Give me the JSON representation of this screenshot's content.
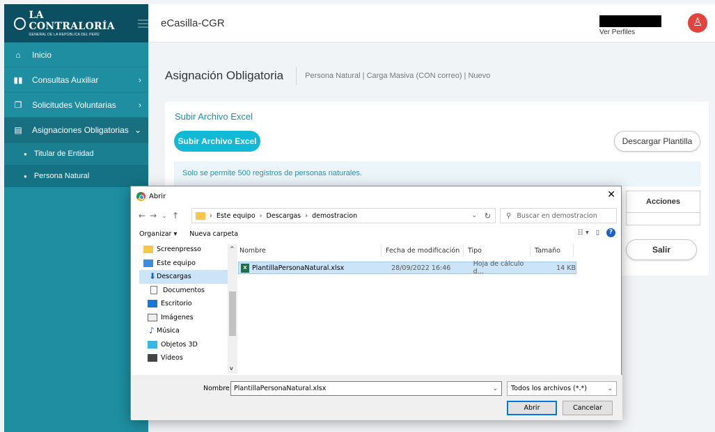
{
  "sidebar": {
    "logo_title": "LA CONTRALORÍA",
    "logo_subtitle": "GENERAL DE LA REPÚBLICA DEL PERÚ",
    "items": [
      {
        "label": "Inicio",
        "icon": "home-icon",
        "chevron": ""
      },
      {
        "label": "Consultas Auxiliar",
        "icon": "bar-chart-icon",
        "chevron": "›"
      },
      {
        "label": "Solicitudes Voluntarias",
        "icon": "document-copy-icon",
        "chevron": "›"
      },
      {
        "label": "Asignaciones Obligatorias",
        "icon": "clipboard-icon",
        "chevron": "⌄"
      }
    ],
    "subitems": [
      {
        "label": "Titular de Entidad"
      },
      {
        "label": "Persona Natural"
      }
    ]
  },
  "topbar": {
    "app_title": "eCasilla-CGR",
    "ver_perfiles": "Ver Perfiles",
    "avatar_icon": "user-icon"
  },
  "page": {
    "title": "Asignación Obligatoria",
    "subtitle": "Persona Natural | Carga Masiva (CON correo) | Nuevo"
  },
  "card": {
    "title": "Subir Archivo Excel",
    "upload_label": "Subir Archivo Excel",
    "download_label": "Descargar Plantilla",
    "notice": "Solo se permite 500 registros de personas naturales.",
    "col_acciones": "Acciones",
    "salir_label": "Salir"
  },
  "dialog": {
    "title": "Abrir",
    "close": "✕",
    "path": [
      "Este equipo",
      "Descargas",
      "demostracion"
    ],
    "search_placeholder": "Buscar en demostracion",
    "organize": "Organizar ▾",
    "new_folder": "Nueva carpeta",
    "tree": [
      {
        "label": "Screenpresso",
        "icon": "folder-icon",
        "selected": false
      },
      {
        "label": "Este equipo",
        "icon": "computer-icon",
        "selected": false
      },
      {
        "label": "Descargas",
        "icon": "download-icon",
        "selected": true
      },
      {
        "label": "Documentos",
        "icon": "document-icon",
        "selected": false
      },
      {
        "label": "Escritorio",
        "icon": "desktop-icon",
        "selected": false
      },
      {
        "label": "Imágenes",
        "icon": "image-icon",
        "selected": false
      },
      {
        "label": "Música",
        "icon": "music-icon",
        "selected": false
      },
      {
        "label": "Objetos 3D",
        "icon": "cube-icon",
        "selected": false
      },
      {
        "label": "Vídeos",
        "icon": "video-icon",
        "selected": false
      }
    ],
    "columns": [
      "Nombre",
      "Fecha de modificación",
      "Tipo",
      "Tamaño"
    ],
    "file": {
      "name": "PlantillaPersonaNatural.xlsx",
      "modified": "28/09/2022 16:46",
      "type": "Hoja de cálculo d...",
      "size": "14 KB"
    },
    "filename_label": "Nombre:",
    "filename_value": "PlantillaPersonaNatural.xlsx",
    "filter": "Todos los archivos (*.*)",
    "open_label": "Abrir",
    "cancel_label": "Cancelar"
  },
  "colors": {
    "sidebar": "#1e8ea0",
    "logo_bar": "#0d4f62",
    "accent": "#12b9d6",
    "avatar": "#e2433d"
  }
}
